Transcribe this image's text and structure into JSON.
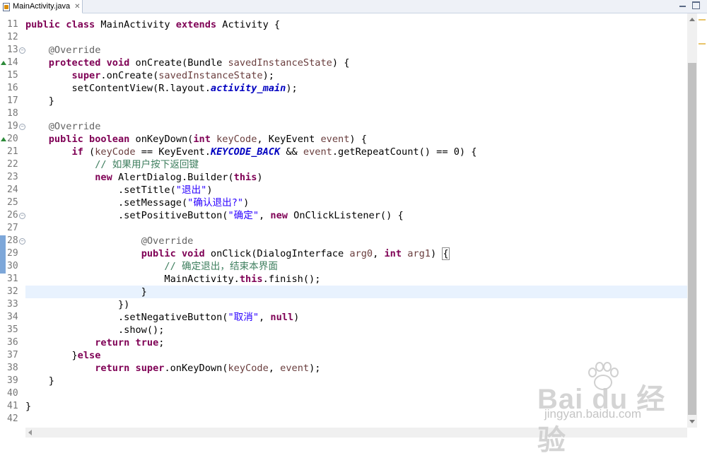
{
  "tab": {
    "filename": "MainActivity.java",
    "close_glyph": "✕"
  },
  "lines": [
    {
      "n": "11",
      "html": "<span class='kw'>public</span> <span class='kw'>class</span> MainActivity <span class='kw'>extends</span> Activity {"
    },
    {
      "n": "12",
      "html": ""
    },
    {
      "n": "13",
      "html": "    <span class='ann'>@Override</span>",
      "fold": true
    },
    {
      "n": "14",
      "html": "    <span class='kw'>protected</span> <span class='kw'>void</span> onCreate(Bundle <span class='par'>savedInstanceState</span>) {",
      "override": true
    },
    {
      "n": "15",
      "html": "        <span class='kw'>super</span>.onCreate(<span class='par'>savedInstanceState</span>);"
    },
    {
      "n": "16",
      "html": "        setContentView(R.layout.<span class='fld'>activity_main</span>);"
    },
    {
      "n": "17",
      "html": "    }"
    },
    {
      "n": "18",
      "html": ""
    },
    {
      "n": "19",
      "html": "    <span class='ann'>@Override</span>",
      "fold": true
    },
    {
      "n": "20",
      "html": "    <span class='kw'>public</span> <span class='kw'>boolean</span> onKeyDown(<span class='kw'>int</span> <span class='par'>keyCode</span>, KeyEvent <span class='par'>event</span>) {",
      "override": true
    },
    {
      "n": "21",
      "html": "        <span class='kw'>if</span> (<span class='par'>keyCode</span> == KeyEvent.<span class='fld'>KEYCODE_BACK</span> &amp;&amp; <span class='par'>event</span>.getRepeatCount() == 0) {"
    },
    {
      "n": "22",
      "html": "            <span class='com'>// 如果用户按下返回键</span>"
    },
    {
      "n": "23",
      "html": "            <span class='kw'>new</span> AlertDialog.Builder(<span class='kw'>this</span>)"
    },
    {
      "n": "24",
      "html": "                .setTitle(<span class='str'>\"退出\"</span>)"
    },
    {
      "n": "25",
      "html": "                .setMessage(<span class='str'>\"确认退出?\"</span>)"
    },
    {
      "n": "26",
      "html": "                .setPositiveButton(<span class='str'>\"确定\"</span>, <span class='kw'>new</span> OnClickListener() {",
      "fold": true
    },
    {
      "n": "27",
      "html": ""
    },
    {
      "n": "28",
      "html": "                    <span class='ann'>@Override</span>",
      "fold": true
    },
    {
      "n": "29",
      "html": "                    <span class='kw'>public</span> <span class='kw'>void</span> onClick(DialogInterface <span class='par'>arg0</span>, <span class='kw'>int</span> <span class='par'>arg1</span>) <span class='bracket'>{</span>"
    },
    {
      "n": "30",
      "html": "                        <span class='com'>// 确定退出，结束本界面</span>"
    },
    {
      "n": "31",
      "html": "                        MainActivity.<span class='kw'>this</span>.finish();"
    },
    {
      "n": "32",
      "html": "                    }",
      "current": true
    },
    {
      "n": "33",
      "html": "                })"
    },
    {
      "n": "34",
      "html": "                .setNegativeButton(<span class='str'>\"取消\"</span>, <span class='kw'>null</span>)"
    },
    {
      "n": "35",
      "html": "                .show();"
    },
    {
      "n": "36",
      "html": "            <span class='kw'>return</span> <span class='kw'>true</span>;"
    },
    {
      "n": "37",
      "html": "        }<span class='kw'>else</span>"
    },
    {
      "n": "38",
      "html": "            <span class='kw'>return</span> <span class='kw'>super</span>.onKeyDown(<span class='par'>keyCode</span>, <span class='par'>event</span>);"
    },
    {
      "n": "39",
      "html": "    }"
    },
    {
      "n": "40",
      "html": ""
    },
    {
      "n": "41",
      "html": "}"
    },
    {
      "n": "42",
      "html": ""
    }
  ],
  "watermark": {
    "brand": "Bai du 经验",
    "url": "jingyan.baidu.com"
  },
  "colors": {
    "keyword": "#7f0055",
    "string": "#2a00ff",
    "comment": "#3f7f5f",
    "annotation": "#646464",
    "current_line": "#e8f2fe"
  }
}
